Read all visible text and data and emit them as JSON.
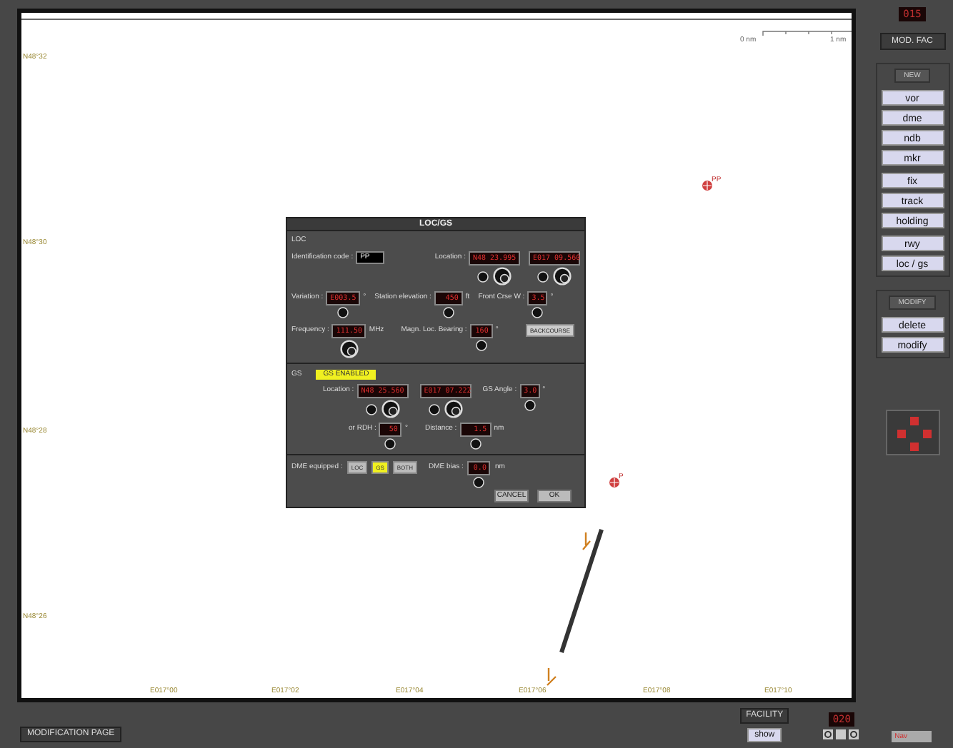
{
  "map": {
    "lat_labels": [
      "N48°32",
      "N48°30",
      "N48°28",
      "N48°26"
    ],
    "lon_labels": [
      "E017°00",
      "E017°02",
      "E017°04",
      "E017°06",
      "E017°08",
      "E017°10"
    ],
    "scale": {
      "start": "0 nm",
      "end": "1 nm"
    },
    "waypoints": [
      {
        "label": "PP"
      },
      {
        "label": "P"
      }
    ]
  },
  "dialog": {
    "title": "LOC/GS",
    "loc": {
      "heading": "LOC",
      "id_label": "Identification code :",
      "id_value": "PP",
      "location_label": "Location :",
      "lat": "N48 23.995",
      "lon": "E017 09.560",
      "variation_label": "Variation :",
      "variation": "E003.5",
      "variation_unit": "°",
      "elevation_label": "Station elevation :",
      "elevation": "450",
      "elevation_unit": "ft",
      "front_label": "Front Crse W :",
      "front": "3.5",
      "front_unit": "°",
      "frequency_label": "Frequency :",
      "frequency": "111.50",
      "frequency_unit": "MHz",
      "bearing_label": "Magn. Loc. Bearing :",
      "bearing": "160",
      "bearing_unit": "°",
      "backcourse": "BACKCOURSE"
    },
    "gs": {
      "heading": "GS",
      "status": "GS ENABLED",
      "location_label": "Location :",
      "lat": "N48 25.560",
      "lon": "E017 07.222",
      "angle_label": "GS Angle :",
      "angle": "3.0",
      "angle_unit": "°",
      "rdh_label": "or RDH :",
      "rdh": "50",
      "rdh_unit": "°",
      "distance_label": "Distance :",
      "distance": "1.5",
      "distance_unit": "nm"
    },
    "dme": {
      "label": "DME equipped :",
      "options": [
        {
          "label": "LOC",
          "selected": false
        },
        {
          "label": "GS",
          "selected": true
        },
        {
          "label": "BOTH",
          "selected": false
        }
      ],
      "bias_label": "DME bias :",
      "bias": "0.0",
      "bias_unit": "nm"
    },
    "buttons": [
      "CANCEL",
      "OK"
    ]
  },
  "sidebar": {
    "counter": "015",
    "mod_fac": "MOD. FAC",
    "groups": [
      {
        "title": "NEW",
        "items": [
          [
            "vor",
            "dme",
            "ndb",
            "mkr"
          ],
          [
            "fix",
            "track",
            "holding"
          ],
          [
            "rwy",
            "loc / gs"
          ]
        ]
      },
      {
        "title": "MODIFY",
        "items": [
          [
            "delete",
            "modify"
          ]
        ]
      }
    ]
  },
  "bottom": {
    "modification": "MODIFICATION PAGE",
    "facility": "FACILITY",
    "show": "show",
    "range": "020",
    "mode": "Nav"
  }
}
